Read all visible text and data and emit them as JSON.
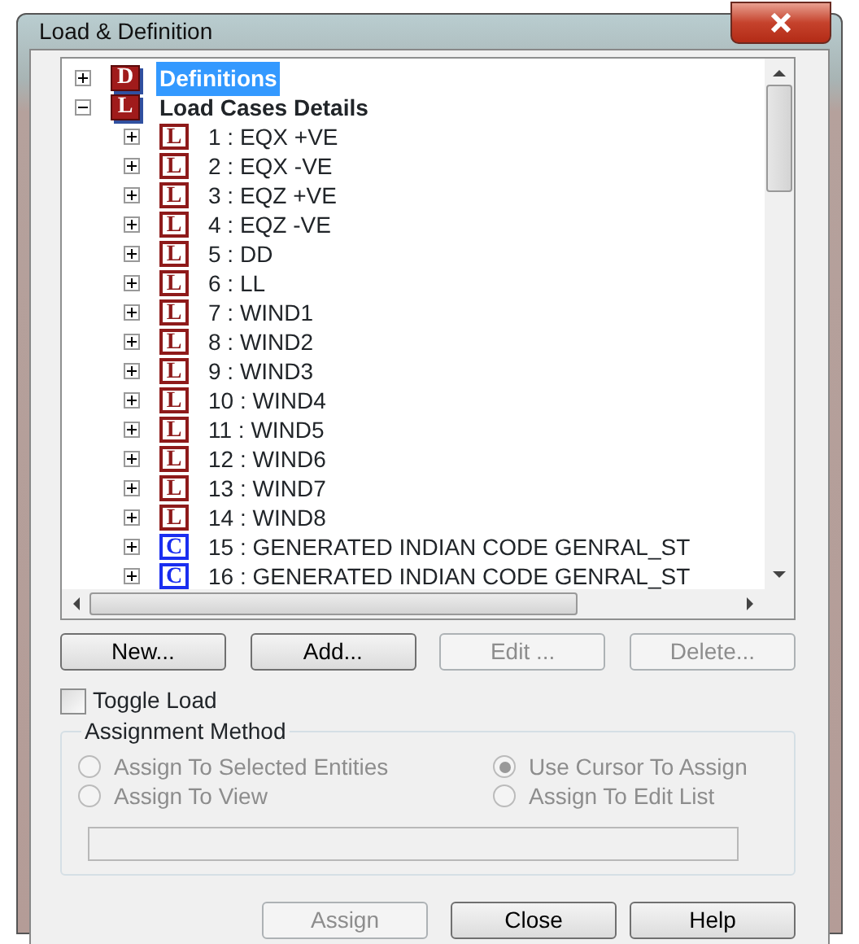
{
  "window": {
    "title": "Load & Definition"
  },
  "tree": [
    {
      "kind": "group",
      "icon": "D",
      "label": "Definitions",
      "expanded": false,
      "selected": true
    },
    {
      "kind": "group",
      "icon": "L",
      "label": "Load Cases Details",
      "expanded": true,
      "selected": false,
      "children": [
        {
          "kind": "load",
          "icon": "L",
          "label": "1 : EQX +VE",
          "expanded": false,
          "selected": false
        },
        {
          "kind": "load",
          "icon": "L",
          "label": "2 : EQX -VE",
          "expanded": false,
          "selected": false
        },
        {
          "kind": "load",
          "icon": "L",
          "label": "3 : EQZ +VE",
          "expanded": false,
          "selected": false
        },
        {
          "kind": "load",
          "icon": "L",
          "label": "4 : EQZ -VE",
          "expanded": false,
          "selected": false
        },
        {
          "kind": "load",
          "icon": "L",
          "label": "5 : DD",
          "expanded": false,
          "selected": false
        },
        {
          "kind": "load",
          "icon": "L",
          "label": "6 : LL",
          "expanded": false,
          "selected": false
        },
        {
          "kind": "load",
          "icon": "L",
          "label": "7 : WIND1",
          "expanded": false,
          "selected": false
        },
        {
          "kind": "load",
          "icon": "L",
          "label": "8 : WIND2",
          "expanded": false,
          "selected": false
        },
        {
          "kind": "load",
          "icon": "L",
          "label": "9 : WIND3",
          "expanded": false,
          "selected": false
        },
        {
          "kind": "load",
          "icon": "L",
          "label": "10 : WIND4",
          "expanded": false,
          "selected": false
        },
        {
          "kind": "load",
          "icon": "L",
          "label": "11 : WIND5",
          "expanded": false,
          "selected": false
        },
        {
          "kind": "load",
          "icon": "L",
          "label": "12 : WIND6",
          "expanded": false,
          "selected": false
        },
        {
          "kind": "load",
          "icon": "L",
          "label": "13 : WIND7",
          "expanded": false,
          "selected": false
        },
        {
          "kind": "load",
          "icon": "L",
          "label": "14 : WIND8",
          "expanded": false,
          "selected": false
        },
        {
          "kind": "combination",
          "icon": "C",
          "label": "15 : GENERATED INDIAN CODE GENRAL_ST",
          "expanded": false,
          "selected": false
        },
        {
          "kind": "combination",
          "icon": "C",
          "label": "16 : GENERATED INDIAN CODE GENRAL_ST",
          "expanded": false,
          "selected": false
        }
      ]
    }
  ],
  "actions": [
    {
      "label": "New...",
      "disabled": false
    },
    {
      "label": "Add...",
      "disabled": false
    },
    {
      "label": "Edit ...",
      "disabled": true
    },
    {
      "label": "Delete...",
      "disabled": true
    }
  ],
  "toggle_load": {
    "label": "Toggle Load",
    "checked": false
  },
  "assignment_method": {
    "title": "Assignment Method",
    "options": [
      {
        "label": "Assign To Selected Entities",
        "selected": false,
        "disabled": true
      },
      {
        "label": "Use Cursor To Assign",
        "selected": true,
        "disabled": true
      },
      {
        "label": "Assign To View",
        "selected": false,
        "disabled": true
      },
      {
        "label": "Assign To Edit List",
        "selected": false,
        "disabled": true
      }
    ]
  },
  "footer_buttons": [
    {
      "label": "Assign",
      "disabled": true
    },
    {
      "label": "Close",
      "disabled": false
    },
    {
      "label": "Help",
      "disabled": false
    }
  ]
}
